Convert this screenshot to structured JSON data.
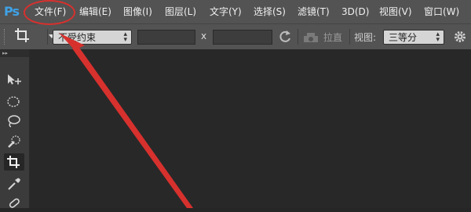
{
  "app": {
    "logo_text": "Ps"
  },
  "menu": {
    "items": [
      "文件(F)",
      "编辑(E)",
      "图像(I)",
      "图层(L)",
      "文字(Y)",
      "选择(S)",
      "滤镜(T)",
      "3D(D)",
      "视图(V)",
      "窗口(W)"
    ]
  },
  "options": {
    "ratio_select": "不受约束",
    "x_separator": "x",
    "straighten_label": "拉直",
    "view_label": "视图:",
    "view_select": "三等分"
  },
  "toolbar": {
    "collapse_glyph": "▸▸"
  },
  "colors": {
    "menubar_bg": "#535353",
    "workspace_bg": "#262626",
    "annotation_red": "#d7312e",
    "logo_blue": "#3fa2e6"
  },
  "icons": [
    "crop-icon",
    "rotate-icon",
    "straighten-icon",
    "gear-icon",
    "move-icon",
    "ellipse-marquee-icon",
    "lasso-icon",
    "quick-selection-icon",
    "crop-tool-icon",
    "eyedropper-icon",
    "healing-brush-icon"
  ]
}
